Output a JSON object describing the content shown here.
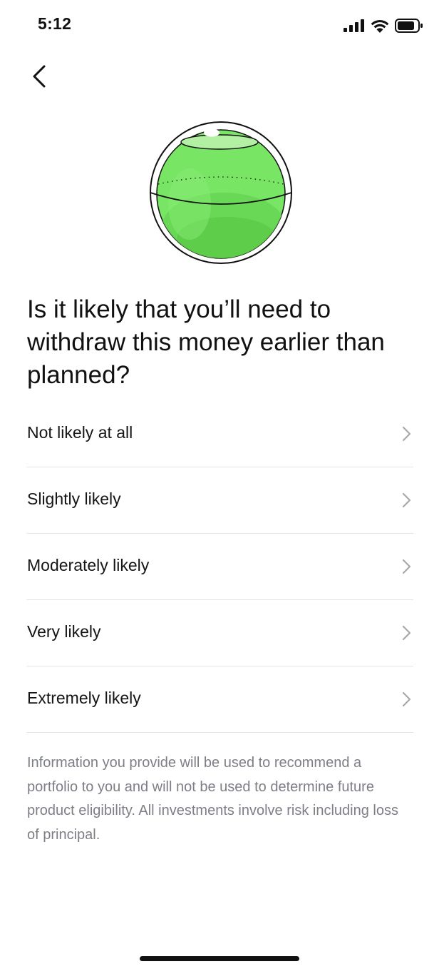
{
  "status_bar": {
    "time": "5:12",
    "icons": [
      "signal-icon",
      "wifi-icon",
      "battery-icon"
    ]
  },
  "navigation": {
    "back_icon": "chevron-left-icon"
  },
  "illustration": {
    "icon": "green-sphere-illustration",
    "colors": {
      "sphere": "#78e564",
      "sphere_shade": "#5ed04a",
      "top_disc": "#b4f0a4",
      "outline": "#111111"
    }
  },
  "question": "Is it likely that you’ll need to withdraw this money earlier than planned?",
  "options": [
    {
      "label": "Not likely at all"
    },
    {
      "label": "Slightly likely"
    },
    {
      "label": "Moderately likely"
    },
    {
      "label": "Very likely"
    },
    {
      "label": "Extremely likely"
    }
  ],
  "option_chevron_icon": "chevron-right-icon",
  "disclaimer": "Information you provide will be used to recommend a portfolio to you and will not be used to determine future product eligibility. All investments involve risk including loss of principal.",
  "colors": {
    "text_primary": "#111111",
    "text_secondary": "#7d7f86",
    "divider": "#e4e4e4",
    "chevron": "#a8a8a8"
  }
}
